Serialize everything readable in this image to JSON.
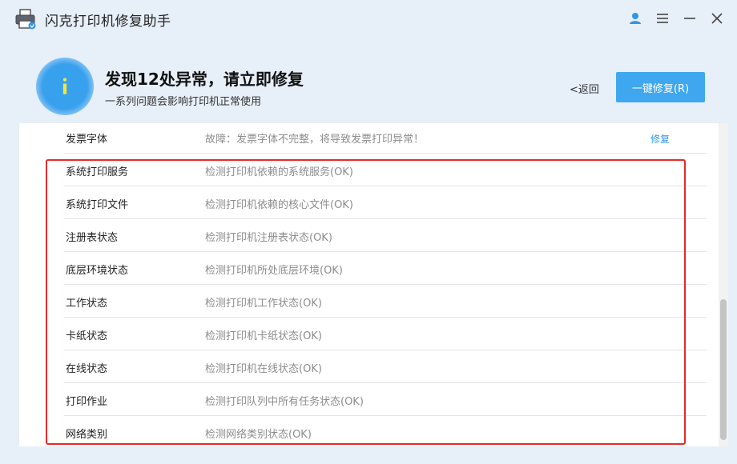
{
  "app": {
    "title": "闪克打印机修复助手",
    "icon": "printer-icon"
  },
  "window_controls": {
    "user": "user-icon",
    "menu": "menu-icon",
    "minimize": "minimize-icon",
    "close": "close-icon"
  },
  "header": {
    "headline": "发现12处异常，请立即修复",
    "subline": "一系列问题会影响打印机正常使用",
    "back_label": "<返回",
    "repair_all_label": "一键修复(R)",
    "info_icon": "info-icon"
  },
  "colors": {
    "accent": "#3fa7ef",
    "link": "#2f96e8",
    "highlight": "#e42a2a",
    "background": "#e7eff8"
  },
  "rows": [
    {
      "name": "发票字体",
      "desc": "故障：发票字体不完整，将导致发票打印异常！",
      "action": "修复"
    },
    {
      "name": "系统打印服务",
      "desc": "检测打印机依赖的系统服务(OK)"
    },
    {
      "name": "系统打印文件",
      "desc": "检测打印机依赖的核心文件(OK)"
    },
    {
      "name": "注册表状态",
      "desc": "检测打印机注册表状态(OK)"
    },
    {
      "name": "底层环境状态",
      "desc": "检测打印机所处底层环境(OK)"
    },
    {
      "name": "工作状态",
      "desc": "检测打印机工作状态(OK)"
    },
    {
      "name": "卡纸状态",
      "desc": "检测打印机卡纸状态(OK)"
    },
    {
      "name": "在线状态",
      "desc": "检测打印机在线状态(OK)"
    },
    {
      "name": "打印作业",
      "desc": "检测打印队列中所有任务状态(OK)"
    },
    {
      "name": "网络类别",
      "desc": "检测网络类别状态(OK)"
    }
  ]
}
